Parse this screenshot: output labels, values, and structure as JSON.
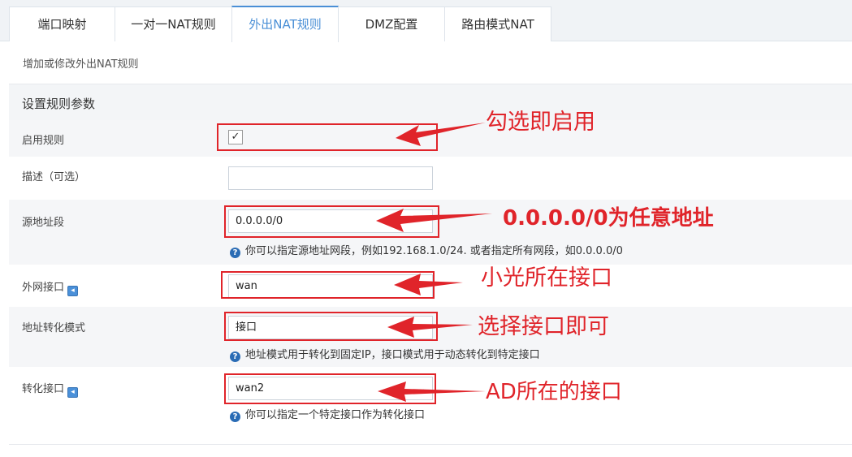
{
  "tabs": [
    {
      "label": "端口映射"
    },
    {
      "label": "一对一NAT规则"
    },
    {
      "label": "外出NAT规则",
      "active": true
    },
    {
      "label": "DMZ配置"
    },
    {
      "label": "路由模式NAT"
    }
  ],
  "page_description": "增加或修改外出NAT规则",
  "section_title": "设置规则参数",
  "form": {
    "enable_rule": {
      "label": "启用规则",
      "checked": true,
      "check_glyph": "✓"
    },
    "description": {
      "label": "描述（可选）",
      "value": ""
    },
    "source_address": {
      "label": "源地址段",
      "value": "0.0.0.0/0",
      "hint": "你可以指定源地址网段，例如192.168.1.0/24. 或者指定所有网段，如0.0.0.0/0"
    },
    "wan_interface": {
      "label": "外网接口",
      "value": "wan"
    },
    "translate_mode": {
      "label": "地址转化模式",
      "value": "接口",
      "hint": "地址模式用于转化到固定IP，接口模式用于动态转化到特定接口"
    },
    "translate_interface": {
      "label": "转化接口",
      "value": "wan2",
      "hint": "你可以指定一个特定接口作为转化接口"
    }
  },
  "annotations": {
    "enable": "勾选即启用",
    "source": "0.0.0.0/0为任意地址",
    "wan": "小光所在接口",
    "mode": "选择接口即可",
    "translate": "AD所在的接口"
  },
  "colors": {
    "accent": "#4a8fd6",
    "annotation": "#e0242a"
  },
  "icons": {
    "help": "question-circle-icon",
    "tip": "info-arrow-icon",
    "dropdown": "chevron-down-icon"
  }
}
